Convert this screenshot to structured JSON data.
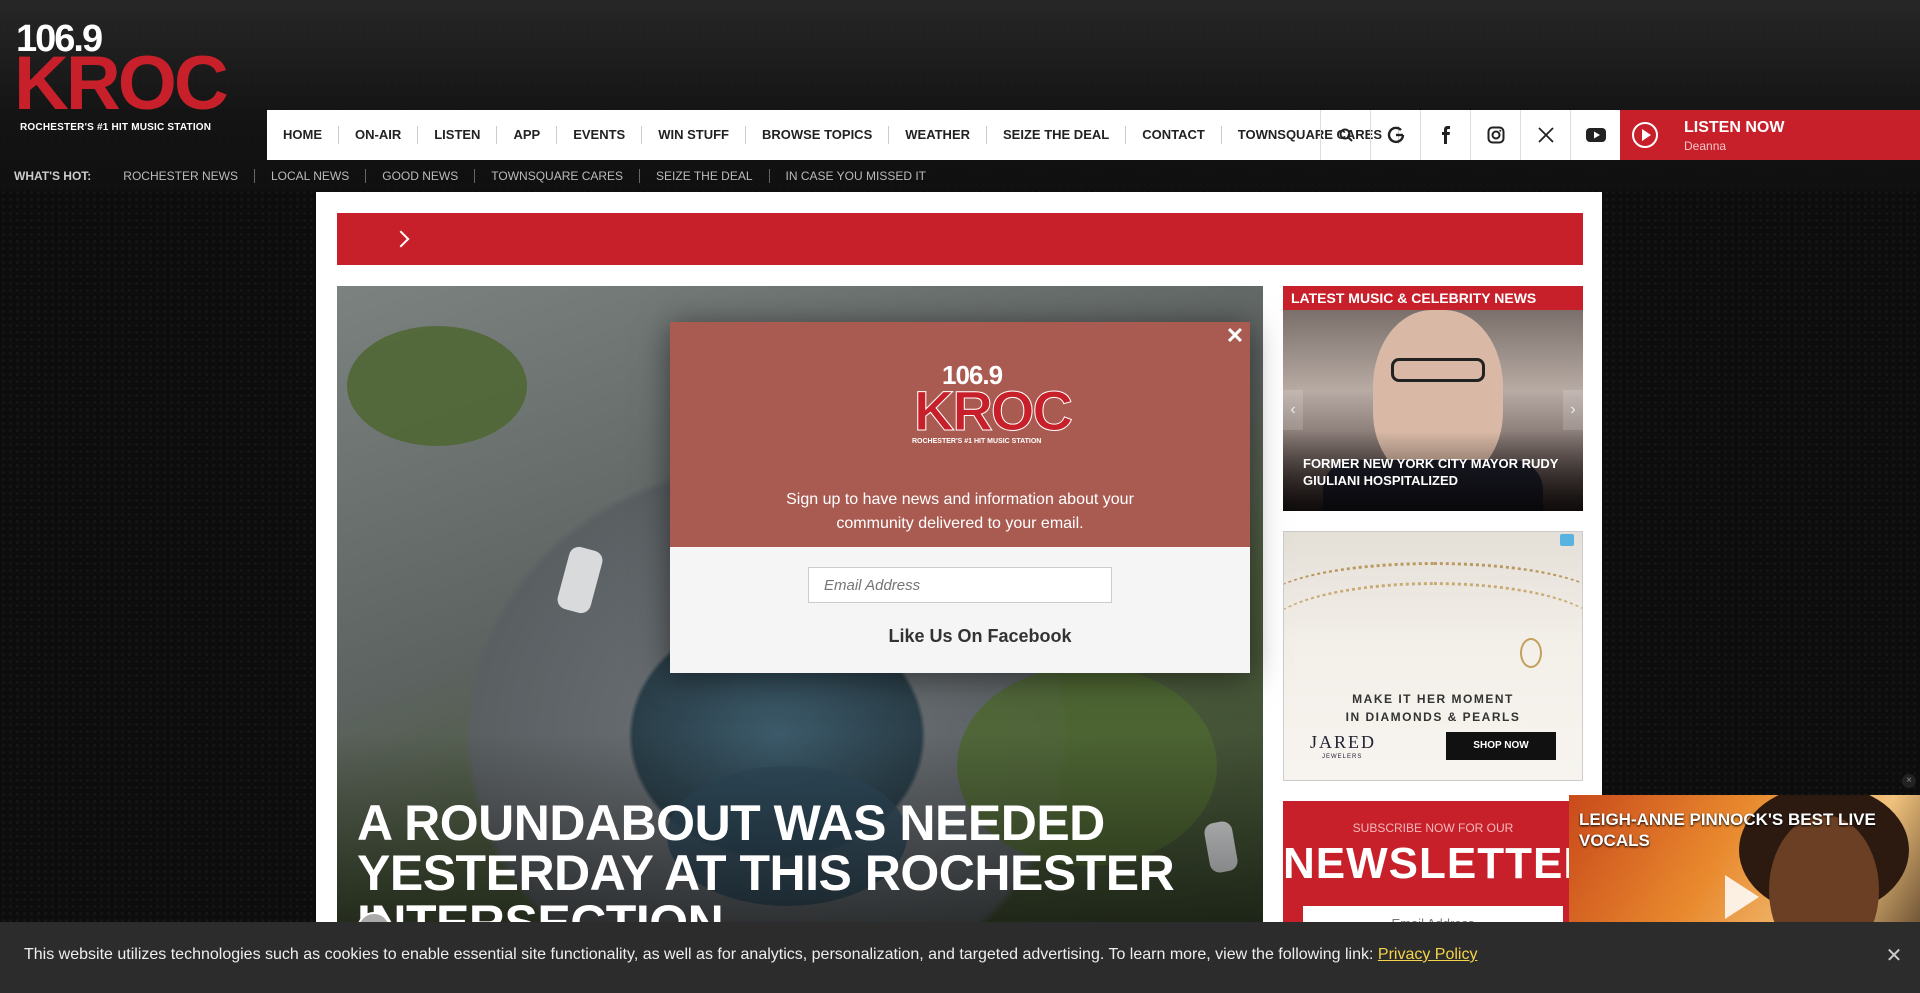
{
  "logo": {
    "num": "106.9",
    "name": "KROC",
    "tagline": "ROCHESTER'S #1 HIT MUSIC STATION"
  },
  "nav": {
    "items": [
      "HOME",
      "ON-AIR",
      "LISTEN",
      "APP",
      "EVENTS",
      "WIN STUFF",
      "BROWSE TOPICS",
      "WEATHER",
      "SEIZE THE DEAL",
      "CONTACT",
      "TOWNSQUARE CARES"
    ],
    "icons": [
      "search-icon",
      "google-icon",
      "facebook-icon",
      "instagram-icon",
      "x-twitter-icon",
      "youtube-icon"
    ]
  },
  "listen": {
    "label": "LISTEN NOW",
    "host": "Deanna"
  },
  "whats_hot": {
    "label": "WHAT'S HOT:",
    "links": [
      "ROCHESTER NEWS",
      "LOCAL NEWS",
      "GOOD NEWS",
      "TOWNSQUARE CARES",
      "SEIZE THE DEAL",
      "IN CASE YOU MISSED IT"
    ]
  },
  "hero": {
    "headline": "A ROUNDABOUT WAS NEEDED YESTERDAY AT THIS ROCHESTER INTERSECTION"
  },
  "sidebar": {
    "heading": "LATEST MUSIC & CELEBRITY NEWS",
    "story": "FORMER NEW YORK CITY MAYOR RUDY GIULIANI HOSPITALIZED"
  },
  "ad": {
    "line1": "MAKE IT HER MOMENT",
    "line2": "IN DIAMONDS & PEARLS",
    "brand": "JARED",
    "brand_sub": "JEWELERS",
    "cta": "SHOP NOW"
  },
  "newsletter": {
    "sub": "SUBSCRIBE NOW FOR OUR",
    "title": "NEWSLETTER",
    "placeholder": "Email Address"
  },
  "video": {
    "title": "LEIGH-ANNE PINNOCK'S BEST LIVE VOCALS"
  },
  "modal": {
    "message": "Sign up to have news and information about your community delivered to your email.",
    "email_placeholder": "Email Address",
    "facebook": "Like Us On Facebook"
  },
  "cookie": {
    "text": "This website utilizes technologies such as cookies to enable essential site functionality, as well as for analytics, personalization, and targeted advertising. To learn more, view the following link: ",
    "link": "Privacy Policy"
  },
  "colors": {
    "brand_red": "#c8202a",
    "modal_top": "#aa5b51",
    "cookie_bg": "#2c2c2c",
    "link_yellow": "#f5d34a"
  }
}
